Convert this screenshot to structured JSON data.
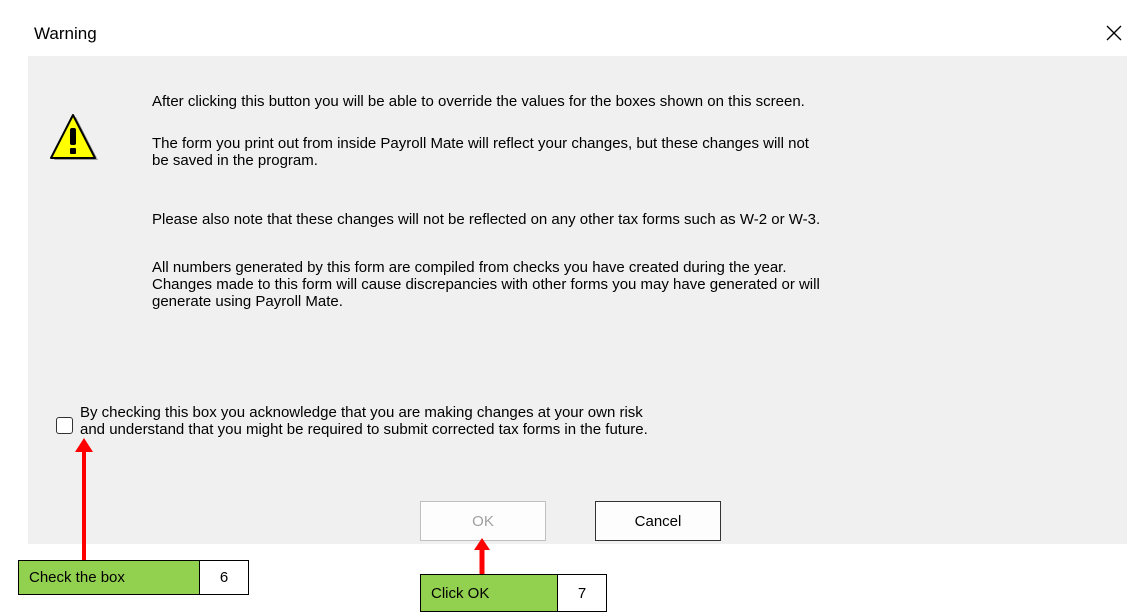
{
  "dialog": {
    "title": "Warning",
    "close_symbol": "✕",
    "icon": "warning-icon",
    "messages": [
      "After clicking this button you will be able to override the values for the boxes shown on this screen.",
      "The form you print out from inside Payroll Mate will reflect your changes, but these changes will not\nbe saved in the program.",
      "Please also note that these changes will not be reflected on any other tax forms such as W-2 or W-3.",
      "All numbers generated by this form are compiled from checks you have created during the year.\nChanges made to this form will cause discrepancies with other forms you may have generated or will\ngenerate using Payroll Mate."
    ],
    "acknowledge": {
      "checked": false,
      "label": "By checking this box you acknowledge that you are making changes at your own risk\nand understand that you might be required to submit corrected tax forms in the future."
    },
    "buttons": {
      "ok_label": "OK",
      "ok_enabled": false,
      "cancel_label": "Cancel"
    }
  },
  "annotations": {
    "step6": {
      "label": "Check the box",
      "number": "6"
    },
    "step7": {
      "label": "Click OK",
      "number": "7"
    },
    "arrow_color": "#ff0000",
    "callout_color": "#92d050"
  }
}
